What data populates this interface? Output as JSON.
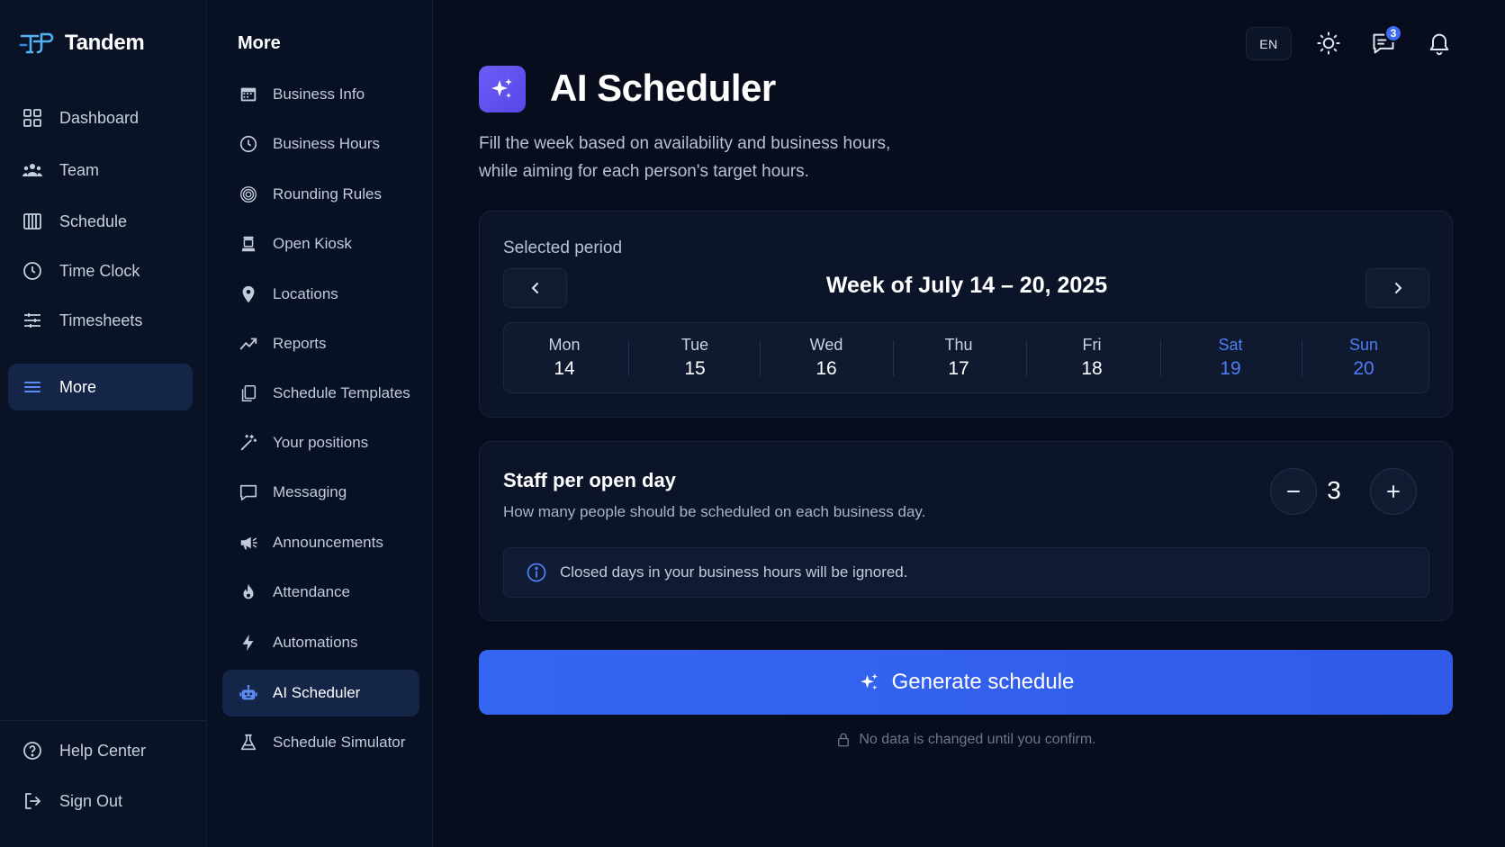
{
  "brand": {
    "name": "Tandem"
  },
  "sidebar": {
    "items": [
      {
        "label": "Dashboard",
        "icon": "dashboard-icon"
      },
      {
        "label": "Team",
        "icon": "team-icon"
      },
      {
        "label": "Schedule",
        "icon": "schedule-icon"
      },
      {
        "label": "Time Clock",
        "icon": "clock-icon"
      },
      {
        "label": "Timesheets",
        "icon": "sliders-icon"
      },
      {
        "label": "More",
        "icon": "menu-icon",
        "active": true
      }
    ],
    "footer": [
      {
        "label": "Help Center",
        "icon": "help-icon"
      },
      {
        "label": "Sign Out",
        "icon": "sign-out-icon"
      }
    ]
  },
  "more": {
    "title": "More",
    "items": [
      {
        "label": "Business Info",
        "icon": "calendar-icon"
      },
      {
        "label": "Business Hours",
        "icon": "clock-icon"
      },
      {
        "label": "Rounding Rules",
        "icon": "target-icon"
      },
      {
        "label": "Open Kiosk",
        "icon": "kiosk-icon"
      },
      {
        "label": "Locations",
        "icon": "location-pin-icon"
      },
      {
        "label": "Reports",
        "icon": "chart-line-icon"
      },
      {
        "label": "Schedule Templates",
        "icon": "copy-icon"
      },
      {
        "label": "Your positions",
        "icon": "magic-wand-icon"
      },
      {
        "label": "Messaging",
        "icon": "chat-icon"
      },
      {
        "label": "Announcements",
        "icon": "megaphone-icon"
      },
      {
        "label": "Attendance",
        "icon": "flame-icon"
      },
      {
        "label": "Automations",
        "icon": "bolt-icon"
      },
      {
        "label": "AI Scheduler",
        "icon": "robot-icon",
        "active": true
      },
      {
        "label": "Schedule Simulator",
        "icon": "flask-icon"
      }
    ]
  },
  "toolbar": {
    "language": "EN",
    "messages_badge": "3",
    "icons": [
      "sun-icon",
      "messages-icon",
      "bell-icon"
    ]
  },
  "page": {
    "title": "AI Scheduler",
    "description_line1": "Fill the week based on availability and business hours,",
    "description_line2": "while aiming for each person's target hours."
  },
  "period": {
    "label": "Selected period",
    "week_title": "Week of July 14 – 20, 2025",
    "days": [
      {
        "name": "Mon",
        "num": "14",
        "weekend": false
      },
      {
        "name": "Tue",
        "num": "15",
        "weekend": false
      },
      {
        "name": "Wed",
        "num": "16",
        "weekend": false
      },
      {
        "name": "Thu",
        "num": "17",
        "weekend": false
      },
      {
        "name": "Fri",
        "num": "18",
        "weekend": false
      },
      {
        "name": "Sat",
        "num": "19",
        "weekend": true
      },
      {
        "name": "Sun",
        "num": "20",
        "weekend": true
      }
    ]
  },
  "staff": {
    "title": "Staff per open day",
    "subtitle": "How many people should be scheduled on each business day.",
    "value": "3",
    "info": "Closed days in your business hours will be ignored."
  },
  "generate": {
    "label": "Generate schedule"
  },
  "footnote": "No data is changed until you confirm.",
  "colors": {
    "background": "#070d1c",
    "accent": "#3566f2",
    "weekend": "#4f7df3",
    "active_nav": "#142548",
    "page_icon": "#6d5cf7"
  }
}
